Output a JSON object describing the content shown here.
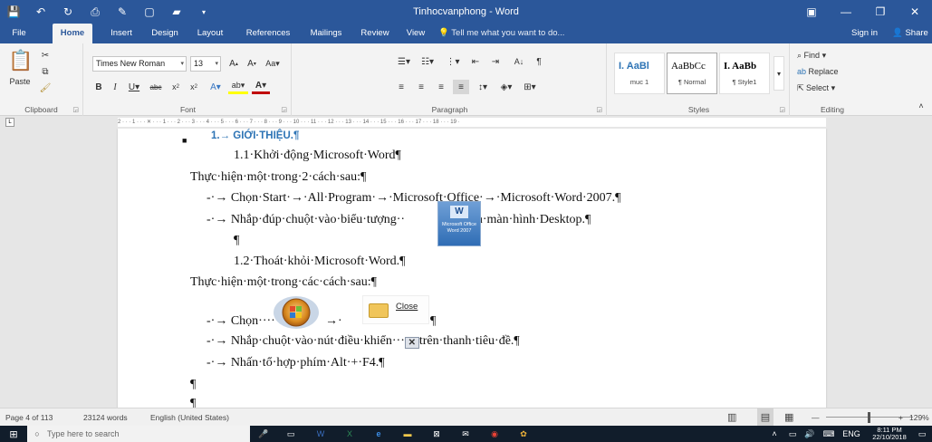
{
  "window": {
    "title": "Tinhocvanphong - Word",
    "sign_in": "Sign in",
    "share": "Share"
  },
  "tabs": [
    "File",
    "Home",
    "Insert",
    "Design",
    "Layout",
    "References",
    "Mailings",
    "Review",
    "View"
  ],
  "active_tab": "Home",
  "tell_me": "Tell me what you want to do...",
  "ribbon": {
    "clipboard": {
      "label": "Clipboard",
      "paste": "Paste"
    },
    "font": {
      "label": "Font",
      "name": "Times New Roman",
      "size": "13"
    },
    "paragraph": {
      "label": "Paragraph"
    },
    "styles": {
      "label": "Styles",
      "items": [
        {
          "preview": "I. AaBl",
          "name": "muc 1"
        },
        {
          "preview": "AaBbCc",
          "name": "¶ Normal"
        },
        {
          "preview": "I. AaBb",
          "name": "¶ Style1"
        }
      ]
    },
    "editing": {
      "label": "Editing",
      "find": "Find",
      "replace": "Replace",
      "select": "Select"
    }
  },
  "ruler": {
    "text": "2 · · · 1 · · · ✕ · · · 1 · · · 2 · · · 3 · · · 4 · · · 5 · · · 6 · · · 7 · · · 8 · · · 9 · · · 10 · · · 11 · · · 12 · · · 13 · · · 14 · · · 15 · · · 16 · · · 17 · · · 18 · · · 19 ·"
  },
  "document": {
    "heading": "1.→ GIỚI·THIỆU.¶",
    "sub1": "1.1·Khởi·động·Microsoft·Word¶",
    "intro1": "Thực·hiện·một·trong·2·cách·sau:¶",
    "step1": "-·→ Chọn·Start·→·All·Program·→·Microsoft·Office·→·Microsoft·Word·2007.¶",
    "step2_before": "-·→ Nhắp·đúp·chuột·vào·biểu·tượng··",
    "step2_after": "···trên·màn·hình·Desktop.¶",
    "word_icon_caption": "Microsoft Office Word 2007",
    "pilcrow": "¶",
    "sub2": "1.2·Thoát·khỏi·Microsoft·Word.¶",
    "intro2": "Thực·hiện·một·trong·các·cách·sau:¶",
    "step3_before": "-·→ Chọn······",
    "step3_arrow": "→·",
    "close_label": "Close",
    "step3_after": "¶",
    "step4_before": "-·→ Nhắp·chuột·vào·nút·điều·khiển···",
    "step4_x": "✕",
    "step4_after": "trên·thanh·tiêu·đề.¶",
    "step5": "-·→ Nhấn·tổ·hợp·phím·Alt·+·F4.¶"
  },
  "status": {
    "page": "Page 4 of 113",
    "words": "23124 words",
    "language": "English (United States)",
    "zoom": "129%"
  },
  "taskbar": {
    "search_placeholder": "Type here to search",
    "lang": "ENG",
    "time": "8:11 PM",
    "date": "22/10/2018"
  }
}
